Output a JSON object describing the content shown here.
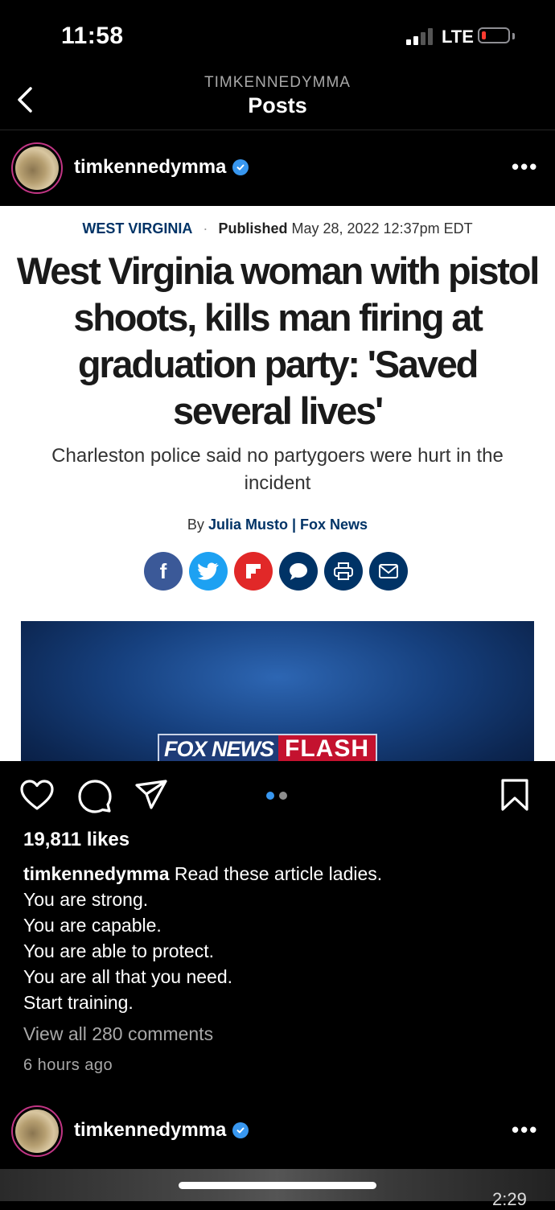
{
  "status_bar": {
    "time": "11:58",
    "network": "LTE"
  },
  "nav": {
    "account": "TIMKENNEDYMMA",
    "title": "Posts"
  },
  "post": {
    "username": "timkennedymma",
    "article": {
      "category": "WEST VIRGINIA",
      "published_label": "Published",
      "published_date": "May 28, 2022 12:37pm EDT",
      "headline": "West Virginia woman with pistol shoots, kills man firing at graduation party: 'Saved several lives'",
      "subheadline": "Charleston police said no partygoers were hurt in the incident",
      "by_label": "By",
      "author": "Julia Musto",
      "outlet": "Fox News",
      "share_buttons": [
        {
          "name": "facebook-icon",
          "glyph": "f",
          "color": "#3b5998"
        },
        {
          "name": "twitter-icon",
          "glyph": "",
          "color": "#1da1f2"
        },
        {
          "name": "flipboard-icon",
          "glyph": "",
          "color": "#e12828"
        },
        {
          "name": "comment-icon",
          "glyph": "",
          "color": "#003366"
        },
        {
          "name": "print-icon",
          "glyph": "",
          "color": "#003366"
        },
        {
          "name": "email-icon",
          "glyph": "",
          "color": "#003366"
        }
      ],
      "video_banner_left": "FOX NEWS",
      "video_banner_right": "FLASH"
    },
    "likes": "19,811 likes",
    "caption_lines": [
      "Read these article ladies.",
      "You are strong.",
      "You are capable.",
      "You are able to protect.",
      "You are all that you need.",
      "Start training."
    ],
    "view_comments": "View all 280 comments",
    "time_ago": "6 hours ago",
    "carousel": {
      "count": 2,
      "active": 1
    }
  },
  "next_post": {
    "username": "timkennedymma",
    "video_time": "2:29"
  },
  "colors": {
    "verified": "#3897f0",
    "carousel_active": "#3897f0",
    "fox_navy": "#003366",
    "flash_red": "#c4122f"
  }
}
